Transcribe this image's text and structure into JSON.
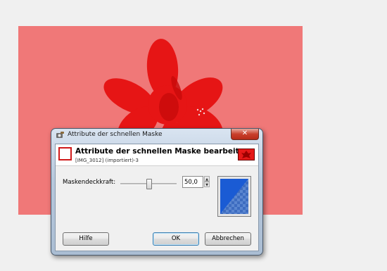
{
  "dialog": {
    "window_title": "Attribute der schnellen Maske",
    "close_glyph": "✕",
    "header_title": "Attribute der schnellen Maske bearbeiten",
    "header_subtitle": "[IMG_3012] (importiert)-3",
    "opacity_label": "Maskendeckkraft:",
    "opacity_value": "50,0",
    "slider_fraction": 0.5,
    "mask_color": "#1a5bd4",
    "help_button": "Hilfe",
    "ok_button": "OK",
    "cancel_button": "Abbrechen"
  },
  "colors": {
    "canvas_background": "#f07878",
    "flower": "#e81010",
    "close_button": "#c9402c"
  }
}
